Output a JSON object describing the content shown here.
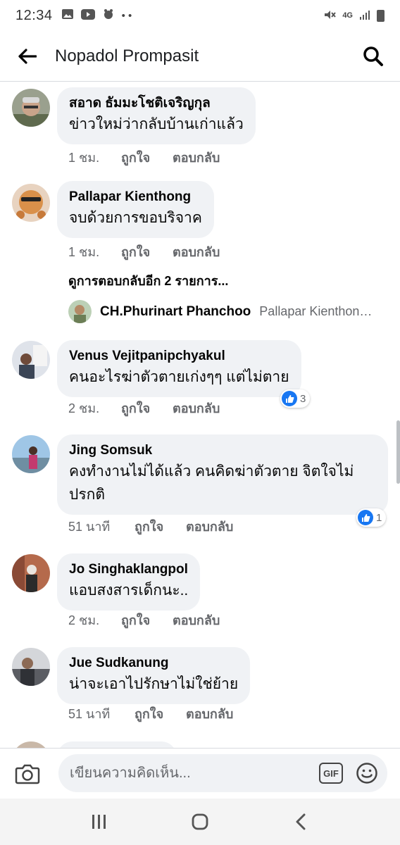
{
  "status_bar": {
    "time": "12:34",
    "network": "4G",
    "left_icons": [
      "image-icon",
      "youtube-icon",
      "bug-icon",
      "more-dots-icon"
    ],
    "right_icons": [
      "mute-icon",
      "signal-icon",
      "battery-icon"
    ]
  },
  "header": {
    "title": "Nopadol Prompasit",
    "back_icon": "arrow-left-icon",
    "search_icon": "search-icon"
  },
  "comments": [
    {
      "name": "สอาด ธัมมะโชติเจริญกุล",
      "text": "ข่าวใหม่ว่ากลับบ้านเก่าแล้ว",
      "time": "1 ชม.",
      "like": "ถูกใจ",
      "reply": "ตอบกลับ"
    },
    {
      "name": "Pallapar Kienthong",
      "text": "จบด้วยการขอบริจาค",
      "time": "1 ชม.",
      "like": "ถูกใจ",
      "reply": "ตอบกลับ",
      "more_replies": "ดูการตอบกลับอีก 2 รายการ...",
      "reply_preview": {
        "name": "CH.Phurinart Phanchoo",
        "text": "Pallapar Kienthon…"
      }
    },
    {
      "name": "Venus Vejitpanipchyakul",
      "text": "คนอะไรฆ่าตัวตายเก่งๆๆ แต่ไม่ตาย",
      "time": "2 ชม.",
      "like": "ถูกใจ",
      "reply": "ตอบกลับ",
      "reaction_count": "3"
    },
    {
      "name": "Jing Somsuk",
      "text_line1": "คงทำงานไม่ได้แล้ว คนคิดฆ่าตัวตาย จิตใจไม่",
      "text_line2": "ปรกติ",
      "time": "51 นาที",
      "like": "ถูกใจ",
      "reply": "ตอบกลับ",
      "reaction_count": "1"
    },
    {
      "name": "Jo Singhaklangpol",
      "text": "แอบสงสารเด็กนะ..",
      "time": "2 ชม.",
      "like": "ถูกใจ",
      "reply": "ตอบกลับ"
    },
    {
      "name": "Jue Sudkanung",
      "text": "น่าจะเอาไปรักษาไม่ใช่ย้าย",
      "time": "51 นาที",
      "like": "ถูกใจ",
      "reply": "ตอบกลับ"
    }
  ],
  "composer": {
    "placeholder": "เขียนความคิดเห็น...",
    "gif_label": "GIF",
    "camera_icon": "camera-icon",
    "emoji_icon": "smiley-icon"
  },
  "nav": {
    "icons": [
      "recent-apps-icon",
      "home-icon",
      "back-icon"
    ]
  },
  "colors": {
    "bubble": "#f0f2f5",
    "meta_text": "#65676b",
    "like_blue": "#1877f2"
  }
}
